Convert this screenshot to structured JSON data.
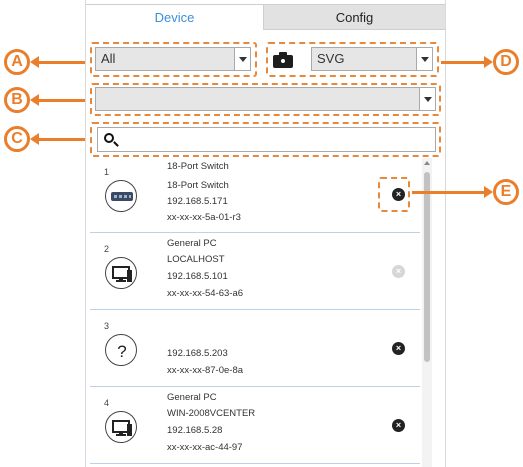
{
  "tabs": {
    "device": "Device",
    "config": "Config"
  },
  "filters": {
    "group_value": "All",
    "format_value": "SVG",
    "secondary_value": ""
  },
  "search": {
    "placeholder": ""
  },
  "devices": [
    {
      "index": "1",
      "icon": "network-switch-icon",
      "type": "18-Port Switch",
      "name": "18-Port Switch",
      "ip": "192.168.5.171",
      "mac": "xx-xx-xx-5a-01-r3",
      "remove_enabled": true
    },
    {
      "index": "2",
      "icon": "computer-icon",
      "type": "General PC",
      "name": "LOCALHOST",
      "ip": "192.168.5.101",
      "mac": "xx-xx-xx-54-63-a6",
      "remove_enabled": false
    },
    {
      "index": "3",
      "icon": "unknown-device-icon",
      "type": "",
      "name": "",
      "ip": "192.168.5.203",
      "mac": "xx-xx-xx-87-0e-8a",
      "remove_enabled": true
    },
    {
      "index": "4",
      "icon": "computer-icon",
      "type": "General PC",
      "name": "WIN-2008VCENTER",
      "ip": "192.168.5.28",
      "mac": "xx-xx-xx-ac-44-97",
      "remove_enabled": true
    }
  ],
  "callouts": {
    "a": "A",
    "b": "B",
    "c": "C",
    "d": "D",
    "e": "E"
  },
  "colors": {
    "accent": "#3d8fd6",
    "callout": "#ea7e2a",
    "divider": "#b9d4ea"
  }
}
